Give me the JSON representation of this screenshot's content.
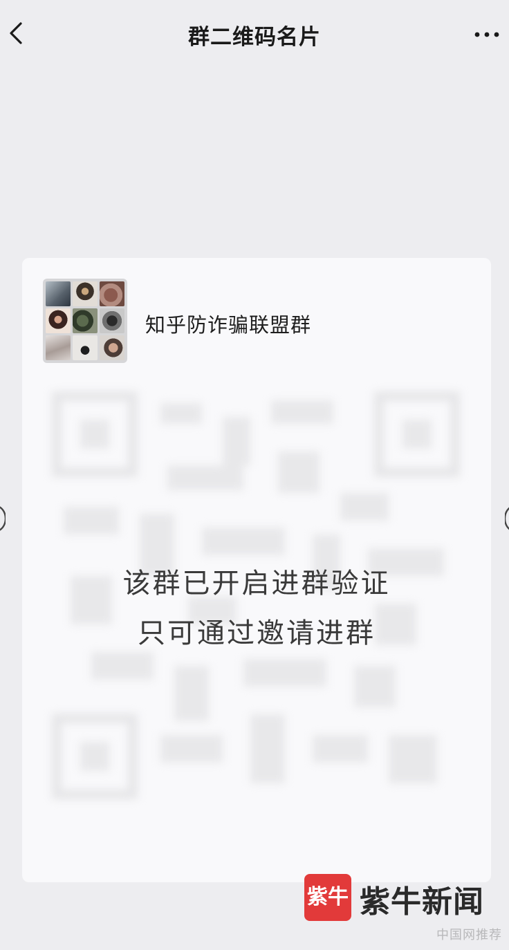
{
  "header": {
    "back_icon": "chevron-left-icon",
    "title": "群二维码名片",
    "more_icon": "more-horizontal-icon"
  },
  "card": {
    "group_name": "知乎防诈骗联盟群",
    "qr_code_state": "blurred",
    "notice_line1": "该群已开启进群验证",
    "notice_line2": "只可通过邀请进群"
  },
  "watermark": {
    "logo_text": "紫牛",
    "brand_name": "紫牛新闻",
    "logo_color": "#e23a3a",
    "source_text": "中国网推荐"
  }
}
